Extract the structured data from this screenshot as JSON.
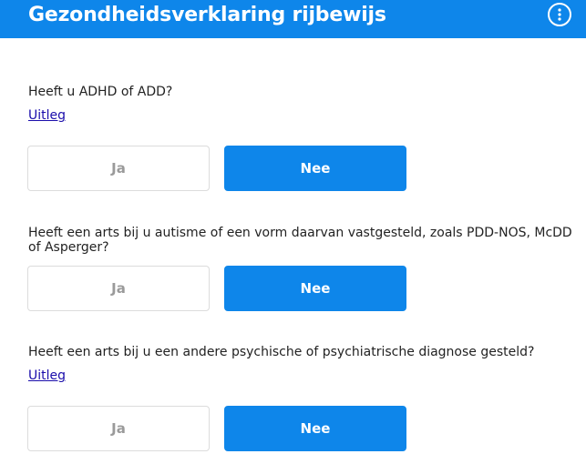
{
  "header": {
    "title": "Gezondheidsverklaring rijbewijs",
    "menu_icon": "more-vertical-icon",
    "color": "#0e86ea"
  },
  "questions": [
    {
      "text": "Heeft u ADHD of ADD?",
      "link": "Uitleg",
      "yes_label": "Ja",
      "no_label": "Nee",
      "selected": "Nee"
    },
    {
      "text": "Heeft een arts bij u autisme of een vorm daarvan vastgesteld, zoals PDD-NOS, McDD of Asperger?",
      "yes_label": "Ja",
      "no_label": "Nee",
      "selected": "Nee"
    },
    {
      "text": "Heeft een arts bij u een andere psychische of psychiatrische diagnose gesteld?",
      "link": "Uitleg",
      "yes_label": "Ja",
      "no_label": "Nee",
      "selected": "Nee"
    }
  ],
  "colors": {
    "accent": "#0e86ea",
    "link": "#1a0dab",
    "unselected_text": "#9a9a9a"
  }
}
